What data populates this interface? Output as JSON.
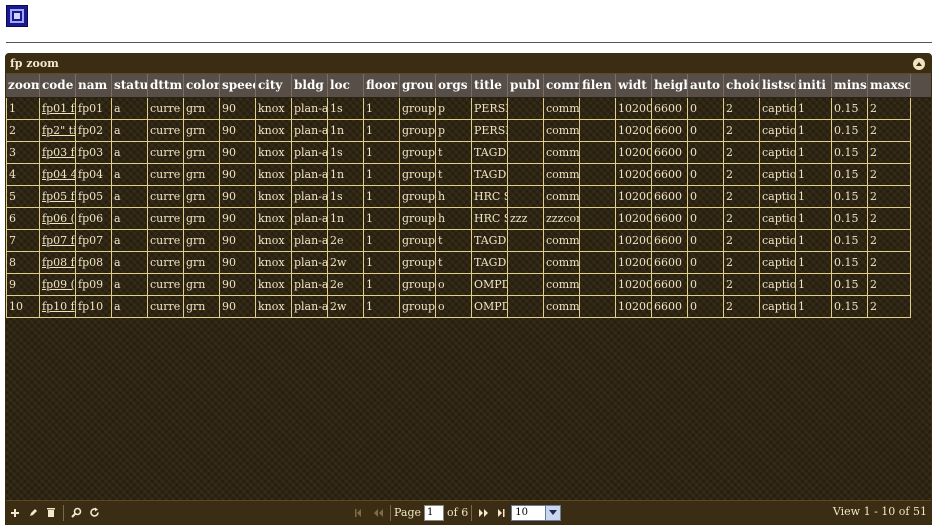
{
  "grid": {
    "caption": "fp zoom",
    "columns": [
      {
        "label": "zoom",
        "w": 34
      },
      {
        "label": "code",
        "w": 36
      },
      {
        "label": "nam",
        "w": 36
      },
      {
        "label": "statu",
        "w": 36
      },
      {
        "label": "dttm",
        "w": 36
      },
      {
        "label": "color",
        "w": 36
      },
      {
        "label": "speed",
        "w": 36
      },
      {
        "label": "city",
        "w": 36
      },
      {
        "label": "bldg",
        "w": 36
      },
      {
        "label": "loc",
        "w": 36
      },
      {
        "label": "floor",
        "w": 36
      },
      {
        "label": "grou",
        "w": 36
      },
      {
        "label": "orgs",
        "w": 36
      },
      {
        "label": "title",
        "w": 36
      },
      {
        "label": "publ",
        "w": 36
      },
      {
        "label": "comr",
        "w": 36
      },
      {
        "label": "filen",
        "w": 36
      },
      {
        "label": "widt",
        "w": 36
      },
      {
        "label": "heigh",
        "w": 36
      },
      {
        "label": "auto",
        "w": 36
      },
      {
        "label": "choic",
        "w": 36
      },
      {
        "label": "listso",
        "w": 36
      },
      {
        "label": "initi",
        "w": 36
      },
      {
        "label": "mins",
        "w": 36
      },
      {
        "label": "maxsc",
        "w": 43
      }
    ],
    "rows": [
      [
        "1",
        "fp01 f",
        "fp01",
        "a",
        "curre",
        "grn",
        "90",
        "knox",
        "plan-a",
        "1s",
        "1",
        "group",
        "p",
        "PERSI",
        "",
        "comm",
        "",
        "10200",
        "6600",
        "0",
        "2",
        "captio",
        "1",
        "0.15",
        "2"
      ],
      [
        "2",
        "fp2\" ti",
        "fp02",
        "a",
        "curre",
        "grn",
        "90",
        "knox",
        "plan-a",
        "1n",
        "1",
        "group",
        "p",
        "PERSI",
        "",
        "comm",
        "",
        "10200",
        "6600",
        "0",
        "2",
        "captio",
        "1",
        "0.15",
        "2"
      ],
      [
        "3",
        "fp03 f",
        "fp03",
        "a",
        "curre",
        "grn",
        "90",
        "knox",
        "plan-a",
        "1s",
        "1",
        "group",
        "t",
        "TAGD",
        "",
        "comm",
        "",
        "10200",
        "6600",
        "0",
        "2",
        "captio",
        "1",
        "0.15",
        "2"
      ],
      [
        "4",
        "fp04 4",
        "fp04",
        "a",
        "curre",
        "grn",
        "90",
        "knox",
        "plan-a",
        "1n",
        "1",
        "group",
        "t",
        "TAGD",
        "",
        "comm",
        "",
        "10200",
        "6600",
        "0",
        "2",
        "captio",
        "1",
        "0.15",
        "2"
      ],
      [
        "5",
        "fp05 f",
        "fp05",
        "a",
        "curre",
        "grn",
        "90",
        "knox",
        "plan-a",
        "1s",
        "1",
        "group",
        "h",
        "HRC S",
        "",
        "comm",
        "",
        "10200",
        "6600",
        "0",
        "2",
        "captio",
        "1",
        "0.15",
        "2"
      ],
      [
        "6",
        "fp06 (",
        "fp06",
        "a",
        "curre",
        "grn",
        "90",
        "knox",
        "plan-a",
        "1n",
        "1",
        "group",
        "h",
        "HRC S",
        "zzz",
        "zzzcon",
        "",
        "10200",
        "6600",
        "0",
        "2",
        "captio",
        "1",
        "0.15",
        "2"
      ],
      [
        "7",
        "fp07 f",
        "fp07",
        "a",
        "curre",
        "grn",
        "90",
        "knox",
        "plan-a",
        "2e",
        "1",
        "group",
        "t",
        "TAGD",
        "",
        "comm",
        "",
        "10200",
        "6600",
        "0",
        "2",
        "captio",
        "1",
        "0.15",
        "2"
      ],
      [
        "8",
        "fp08 f",
        "fp08",
        "a",
        "curre",
        "grn",
        "90",
        "knox",
        "plan-a",
        "2w",
        "1",
        "group",
        "t",
        "TAGD",
        "",
        "comm",
        "",
        "10200",
        "6600",
        "0",
        "2",
        "captio",
        "1",
        "0.15",
        "2"
      ],
      [
        "9",
        "fp09 (",
        "fp09",
        "a",
        "curre",
        "grn",
        "90",
        "knox",
        "plan-a",
        "2e",
        "1",
        "group",
        "o",
        "OMPD",
        "",
        "comm",
        "",
        "10200",
        "6600",
        "0",
        "2",
        "captio",
        "1",
        "0.15",
        "2"
      ],
      [
        "10",
        "fp10 f",
        "fp10",
        "a",
        "curre",
        "grn",
        "90",
        "knox",
        "plan-a",
        "2w",
        "1",
        "group",
        "o",
        "OMPD",
        "",
        "comm",
        "",
        "10200",
        "6600",
        "0",
        "2",
        "captio",
        "1",
        "0.15",
        "2"
      ]
    ]
  },
  "pager": {
    "page_label": "Page",
    "page_value": "1",
    "of_label": "of 6",
    "rows_per_page": "10",
    "view_info": "View 1 - 10 of 51"
  },
  "icons": {
    "add": "plus-icon",
    "edit": "pencil-icon",
    "delete": "trash-icon",
    "search": "search-icon",
    "refresh": "refresh-icon"
  },
  "colors": {
    "grid_bg": "#2e2411",
    "header_bg": "#574f47",
    "cell_border": "#e0cf8a",
    "text": "#f1e5c4"
  }
}
